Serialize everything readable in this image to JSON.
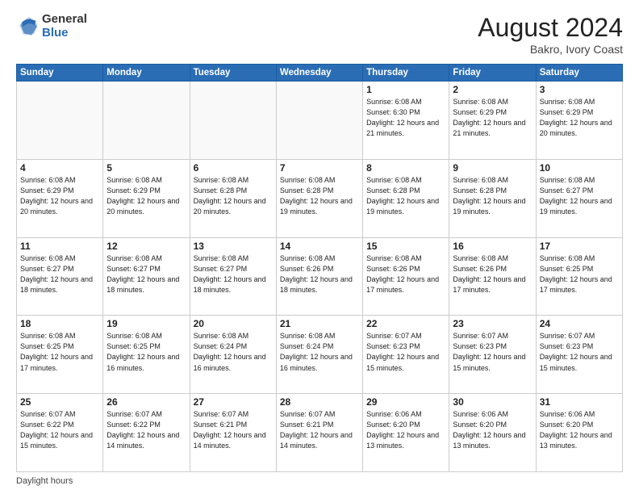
{
  "header": {
    "logo_general": "General",
    "logo_blue": "Blue",
    "month_title": "August 2024",
    "location": "Bakro, Ivory Coast"
  },
  "footer": {
    "label": "Daylight hours"
  },
  "weekdays": [
    "Sunday",
    "Monday",
    "Tuesday",
    "Wednesday",
    "Thursday",
    "Friday",
    "Saturday"
  ],
  "weeks": [
    [
      {
        "day": "",
        "empty": true
      },
      {
        "day": "",
        "empty": true
      },
      {
        "day": "",
        "empty": true
      },
      {
        "day": "",
        "empty": true
      },
      {
        "day": "1",
        "sunrise": "Sunrise: 6:08 AM",
        "sunset": "Sunset: 6:30 PM",
        "daylight": "Daylight: 12 hours and 21 minutes."
      },
      {
        "day": "2",
        "sunrise": "Sunrise: 6:08 AM",
        "sunset": "Sunset: 6:29 PM",
        "daylight": "Daylight: 12 hours and 21 minutes."
      },
      {
        "day": "3",
        "sunrise": "Sunrise: 6:08 AM",
        "sunset": "Sunset: 6:29 PM",
        "daylight": "Daylight: 12 hours and 20 minutes."
      }
    ],
    [
      {
        "day": "4",
        "sunrise": "Sunrise: 6:08 AM",
        "sunset": "Sunset: 6:29 PM",
        "daylight": "Daylight: 12 hours and 20 minutes."
      },
      {
        "day": "5",
        "sunrise": "Sunrise: 6:08 AM",
        "sunset": "Sunset: 6:29 PM",
        "daylight": "Daylight: 12 hours and 20 minutes."
      },
      {
        "day": "6",
        "sunrise": "Sunrise: 6:08 AM",
        "sunset": "Sunset: 6:28 PM",
        "daylight": "Daylight: 12 hours and 20 minutes."
      },
      {
        "day": "7",
        "sunrise": "Sunrise: 6:08 AM",
        "sunset": "Sunset: 6:28 PM",
        "daylight": "Daylight: 12 hours and 19 minutes."
      },
      {
        "day": "8",
        "sunrise": "Sunrise: 6:08 AM",
        "sunset": "Sunset: 6:28 PM",
        "daylight": "Daylight: 12 hours and 19 minutes."
      },
      {
        "day": "9",
        "sunrise": "Sunrise: 6:08 AM",
        "sunset": "Sunset: 6:28 PM",
        "daylight": "Daylight: 12 hours and 19 minutes."
      },
      {
        "day": "10",
        "sunrise": "Sunrise: 6:08 AM",
        "sunset": "Sunset: 6:27 PM",
        "daylight": "Daylight: 12 hours and 19 minutes."
      }
    ],
    [
      {
        "day": "11",
        "sunrise": "Sunrise: 6:08 AM",
        "sunset": "Sunset: 6:27 PM",
        "daylight": "Daylight: 12 hours and 18 minutes."
      },
      {
        "day": "12",
        "sunrise": "Sunrise: 6:08 AM",
        "sunset": "Sunset: 6:27 PM",
        "daylight": "Daylight: 12 hours and 18 minutes."
      },
      {
        "day": "13",
        "sunrise": "Sunrise: 6:08 AM",
        "sunset": "Sunset: 6:27 PM",
        "daylight": "Daylight: 12 hours and 18 minutes."
      },
      {
        "day": "14",
        "sunrise": "Sunrise: 6:08 AM",
        "sunset": "Sunset: 6:26 PM",
        "daylight": "Daylight: 12 hours and 18 minutes."
      },
      {
        "day": "15",
        "sunrise": "Sunrise: 6:08 AM",
        "sunset": "Sunset: 6:26 PM",
        "daylight": "Daylight: 12 hours and 17 minutes."
      },
      {
        "day": "16",
        "sunrise": "Sunrise: 6:08 AM",
        "sunset": "Sunset: 6:26 PM",
        "daylight": "Daylight: 12 hours and 17 minutes."
      },
      {
        "day": "17",
        "sunrise": "Sunrise: 6:08 AM",
        "sunset": "Sunset: 6:25 PM",
        "daylight": "Daylight: 12 hours and 17 minutes."
      }
    ],
    [
      {
        "day": "18",
        "sunrise": "Sunrise: 6:08 AM",
        "sunset": "Sunset: 6:25 PM",
        "daylight": "Daylight: 12 hours and 17 minutes."
      },
      {
        "day": "19",
        "sunrise": "Sunrise: 6:08 AM",
        "sunset": "Sunset: 6:25 PM",
        "daylight": "Daylight: 12 hours and 16 minutes."
      },
      {
        "day": "20",
        "sunrise": "Sunrise: 6:08 AM",
        "sunset": "Sunset: 6:24 PM",
        "daylight": "Daylight: 12 hours and 16 minutes."
      },
      {
        "day": "21",
        "sunrise": "Sunrise: 6:08 AM",
        "sunset": "Sunset: 6:24 PM",
        "daylight": "Daylight: 12 hours and 16 minutes."
      },
      {
        "day": "22",
        "sunrise": "Sunrise: 6:07 AM",
        "sunset": "Sunset: 6:23 PM",
        "daylight": "Daylight: 12 hours and 15 minutes."
      },
      {
        "day": "23",
        "sunrise": "Sunrise: 6:07 AM",
        "sunset": "Sunset: 6:23 PM",
        "daylight": "Daylight: 12 hours and 15 minutes."
      },
      {
        "day": "24",
        "sunrise": "Sunrise: 6:07 AM",
        "sunset": "Sunset: 6:23 PM",
        "daylight": "Daylight: 12 hours and 15 minutes."
      }
    ],
    [
      {
        "day": "25",
        "sunrise": "Sunrise: 6:07 AM",
        "sunset": "Sunset: 6:22 PM",
        "daylight": "Daylight: 12 hours and 15 minutes."
      },
      {
        "day": "26",
        "sunrise": "Sunrise: 6:07 AM",
        "sunset": "Sunset: 6:22 PM",
        "daylight": "Daylight: 12 hours and 14 minutes."
      },
      {
        "day": "27",
        "sunrise": "Sunrise: 6:07 AM",
        "sunset": "Sunset: 6:21 PM",
        "daylight": "Daylight: 12 hours and 14 minutes."
      },
      {
        "day": "28",
        "sunrise": "Sunrise: 6:07 AM",
        "sunset": "Sunset: 6:21 PM",
        "daylight": "Daylight: 12 hours and 14 minutes."
      },
      {
        "day": "29",
        "sunrise": "Sunrise: 6:06 AM",
        "sunset": "Sunset: 6:20 PM",
        "daylight": "Daylight: 12 hours and 13 minutes."
      },
      {
        "day": "30",
        "sunrise": "Sunrise: 6:06 AM",
        "sunset": "Sunset: 6:20 PM",
        "daylight": "Daylight: 12 hours and 13 minutes."
      },
      {
        "day": "31",
        "sunrise": "Sunrise: 6:06 AM",
        "sunset": "Sunset: 6:20 PM",
        "daylight": "Daylight: 12 hours and 13 minutes."
      }
    ]
  ]
}
